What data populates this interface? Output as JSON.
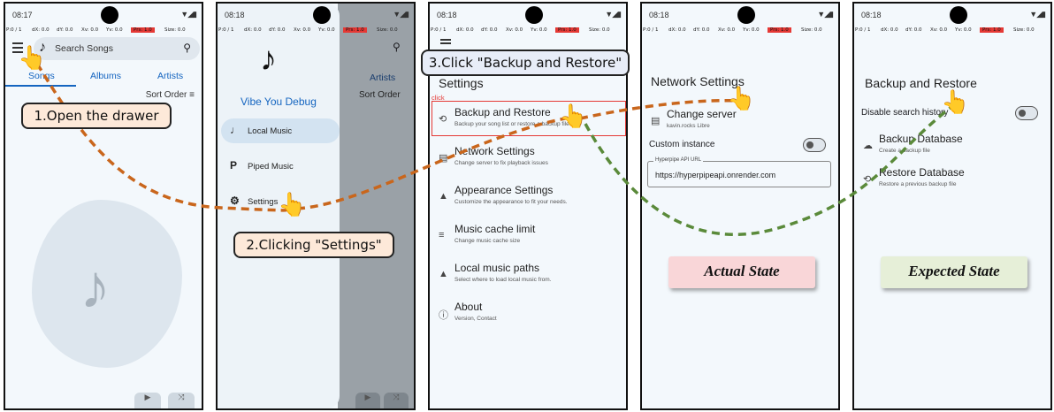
{
  "colors": {
    "accent": "#1565c0",
    "path_orange": "#c9661c",
    "path_green": "#5a8a3a",
    "highlight": "#e53935"
  },
  "status": {
    "time1": "08:17",
    "time": "08:18",
    "signal": "▼◢▮",
    "debug": {
      "p": "P:0 / 1",
      "dx": "dX: 0.0",
      "dy": "dY: 0.0",
      "xv": "Xv: 0.0",
      "yv": "Yv: 0.0",
      "prs": "Prs: 1.0",
      "size": "Size: 0.0"
    }
  },
  "screen1": {
    "search_placeholder": "Search Songs",
    "tabs": [
      "Songs",
      "Albums",
      "Artists"
    ],
    "sort_label": "Sort Order",
    "note_icon": "♪"
  },
  "screen2": {
    "app_name": "Vibe You Debug",
    "items": [
      {
        "icon": "♩",
        "label": "Local Music"
      },
      {
        "icon": "P",
        "label": "Piped Music"
      },
      {
        "icon": "⚙",
        "label": "Settings"
      }
    ],
    "artists_tab": "Artists",
    "sort_label": "Sort Order"
  },
  "screen3": {
    "title": "Settings",
    "click_tag": "click",
    "items": [
      {
        "icon": "⟲",
        "title": "Backup and Restore",
        "subtitle": "Backup your song list or restore a backup file."
      },
      {
        "icon": "▤",
        "title": "Network Settings",
        "subtitle": "Change server to fix playback issues"
      },
      {
        "icon": "▲",
        "title": "Appearance Settings",
        "subtitle": "Customize the appearance to fit your needs."
      },
      {
        "icon": "≡",
        "title": "Music cache limit",
        "subtitle": "Change music cache size"
      },
      {
        "icon": "▲",
        "title": "Local music paths",
        "subtitle": "Select where to load local music from."
      },
      {
        "icon": "ⓘ",
        "title": "About",
        "subtitle": "Version, Contact"
      }
    ]
  },
  "screen4": {
    "title": "Network Settings",
    "change_server": "Change server",
    "change_server_sub": "kavin.rocks Libre",
    "custom_instance": "Custom instance",
    "api_label": "Hyperpipe API URL",
    "api_value": "https://hyperpipeapi.onrender.com",
    "badge": "Actual State"
  },
  "screen5": {
    "title": "Backup and Restore",
    "disable_search": "Disable search history",
    "backup_title": "Backup Database",
    "backup_sub": "Create a backup file",
    "restore_title": "Restore Database",
    "restore_sub": "Restore a previous backup file",
    "badge": "Expected State"
  },
  "callouts": {
    "step1": "1.Open the drawer",
    "step2": "2.Clicking \"Settings\"",
    "step3": "3.Click \"Backup and Restore\""
  }
}
